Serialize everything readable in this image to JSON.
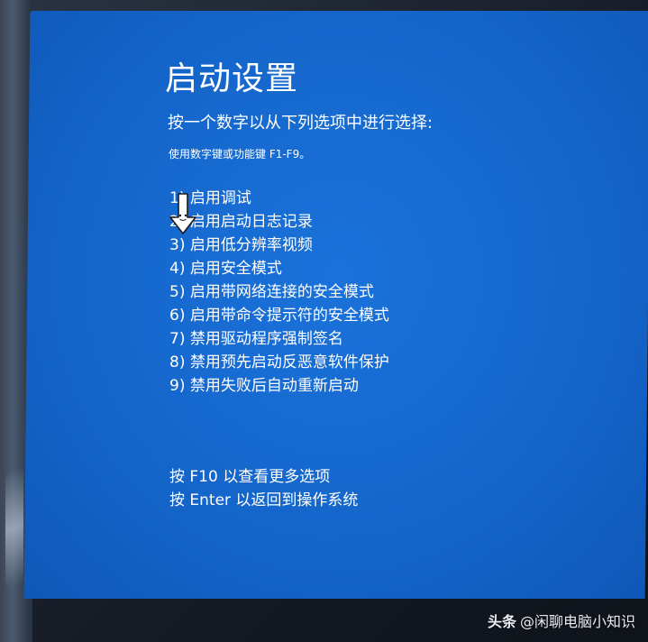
{
  "screen": {
    "title": "启动设置",
    "subtitle": "按一个数字以从下列选项中进行选择:",
    "hint": "使用数字键或功能键 F1-F9。",
    "options": [
      {
        "label": "1) 启用调试"
      },
      {
        "label": "2) 启用启动日志记录"
      },
      {
        "label": "3) 启用低分辨率视频"
      },
      {
        "label": "4) 启用安全模式"
      },
      {
        "label": "5) 启用带网络连接的安全模式"
      },
      {
        "label": "6) 启用带命令提示符的安全模式"
      },
      {
        "label": "7) 禁用驱动程序强制签名"
      },
      {
        "label": "8) 禁用预先启动反恶意软件保护"
      },
      {
        "label": "9) 禁用失败后自动重新启动"
      }
    ],
    "footer": {
      "more_options": "按 F10 以查看更多选项",
      "return_os": "按 Enter 以返回到操作系统"
    }
  },
  "watermark": {
    "brand": "头条",
    "account": "@闲聊电脑小知识"
  },
  "colors": {
    "screen_background": "#1566cb",
    "text": "#ffffff"
  },
  "icons": {
    "cursor": "arrow-down-cursor-icon"
  }
}
